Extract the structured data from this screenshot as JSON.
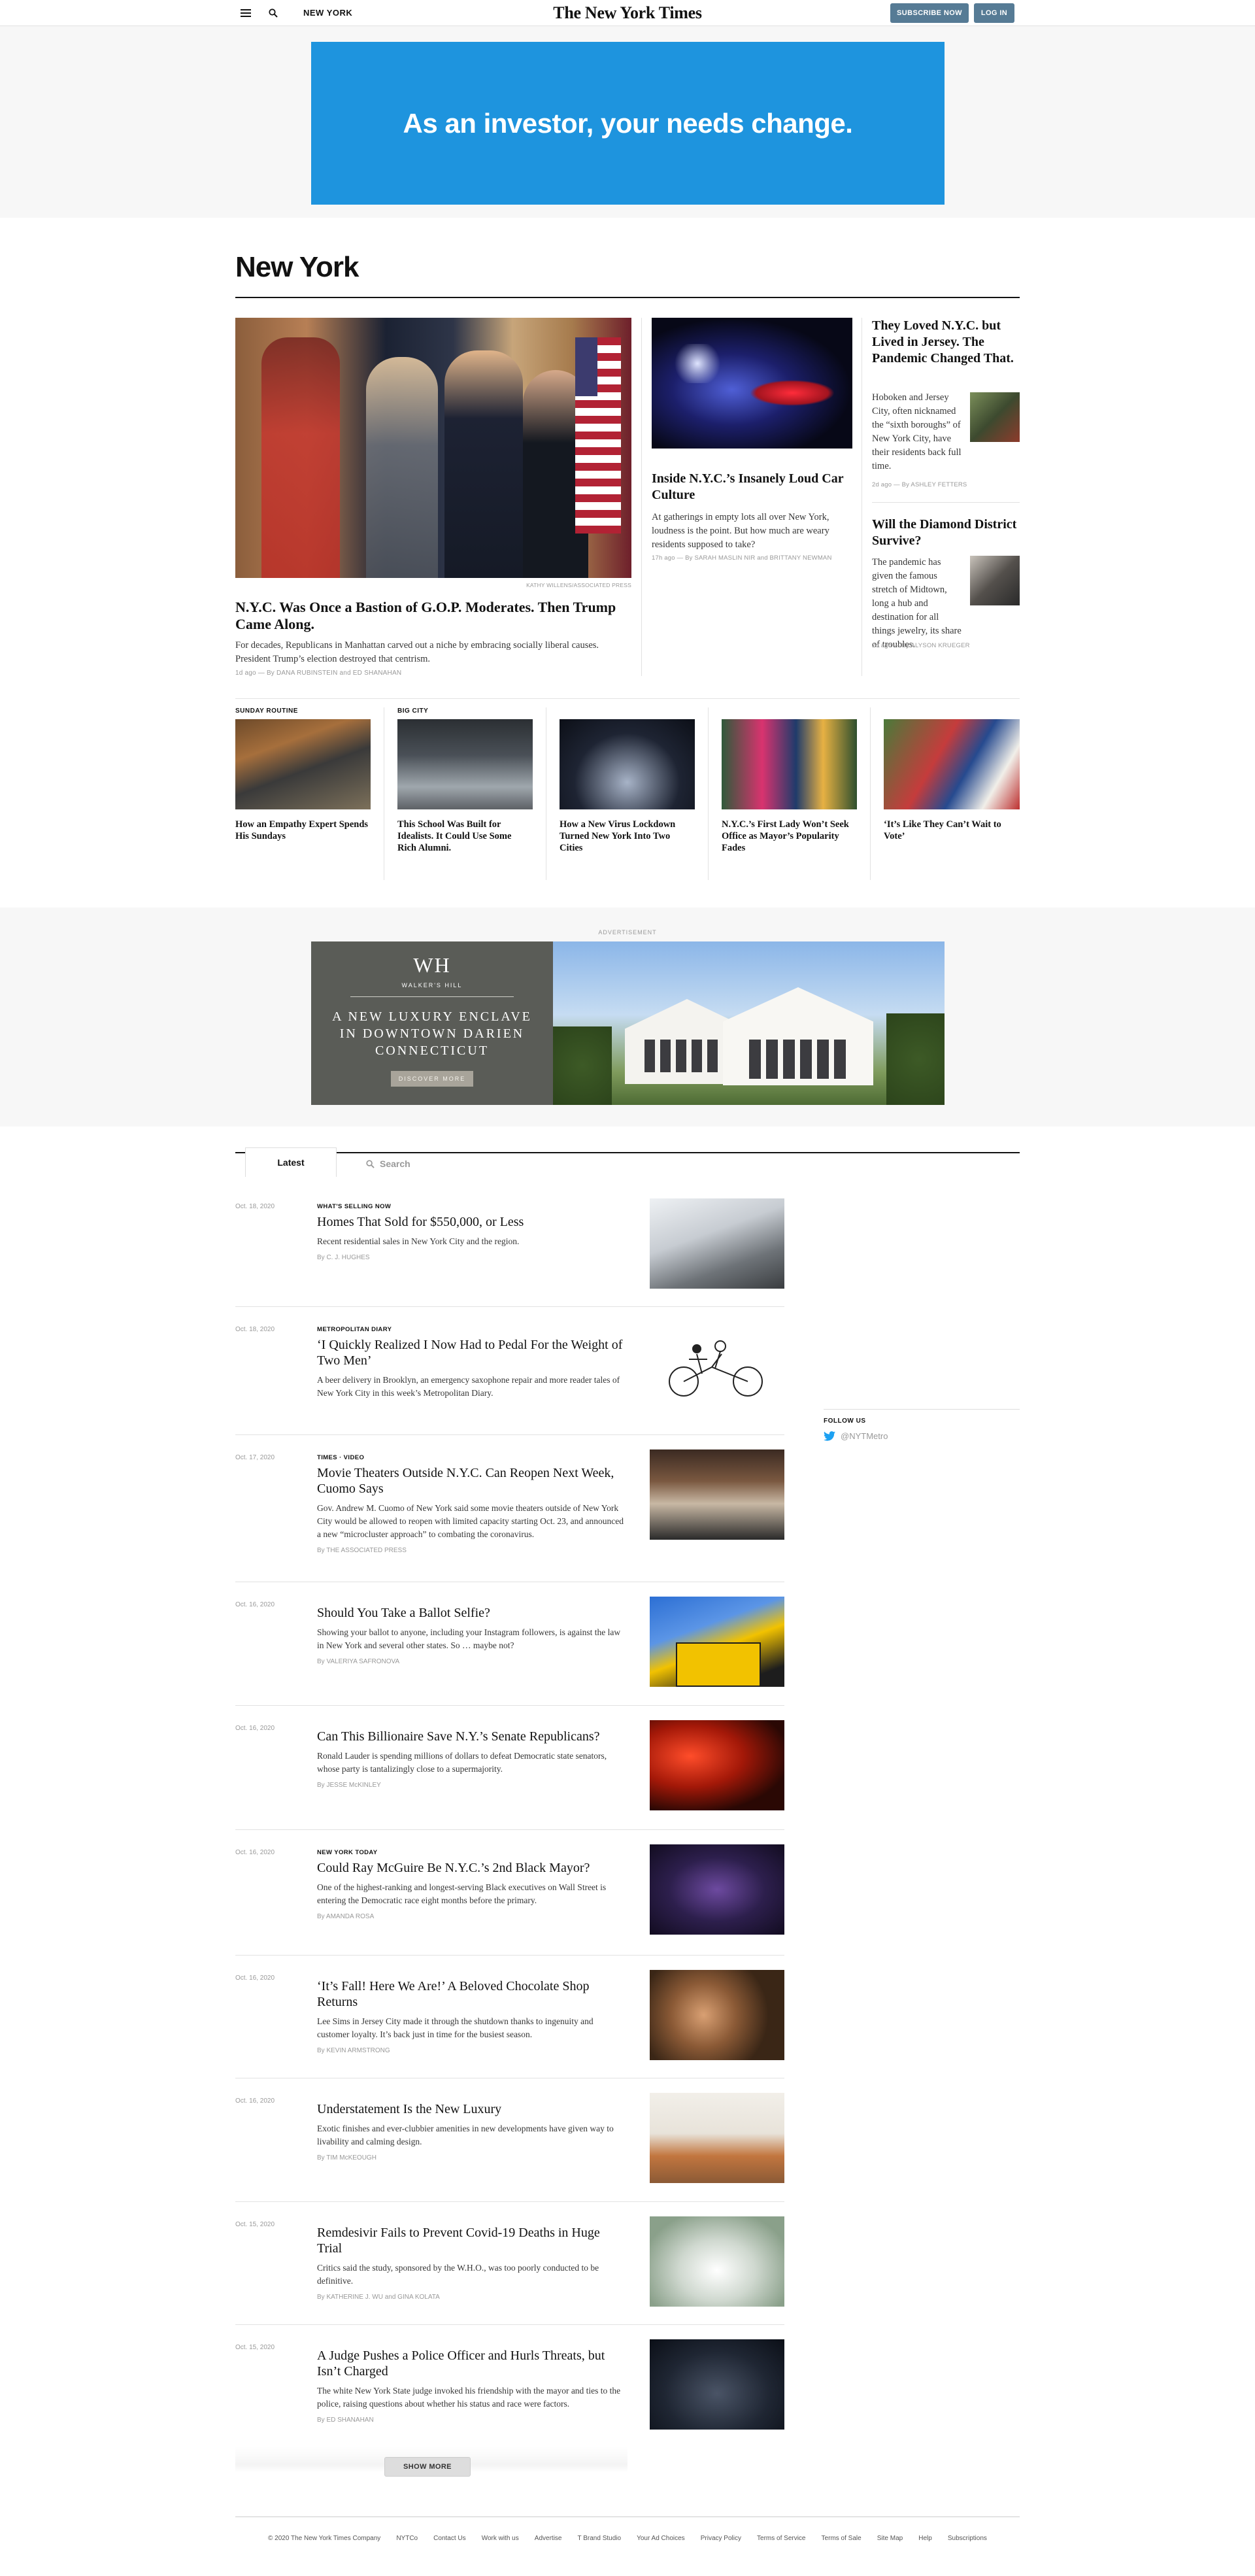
{
  "header": {
    "section_label": "NEW YORK",
    "logo": "The New York Times",
    "subscribe_label": "SUBSCRIBE NOW",
    "login_label": "LOG IN"
  },
  "ad_top": {
    "text": "As an investor, your needs change."
  },
  "section": {
    "title": "New York"
  },
  "lead": {
    "credit": "Kathy Willens/Associated Press",
    "headline": "N.Y.C. Was Once a Bastion of G.O.P. Moderates. Then Trump Came Along.",
    "summary": "For decades, Republicans in Manhattan carved out a niche by embracing socially liberal causes. President Trump’s election destroyed that centrism.",
    "byline": "1d ago — By DANA RUBINSTEIN and ED SHANAHAN"
  },
  "second": {
    "headline": "Inside N.Y.C.’s Insanely Loud Car Culture",
    "summary": "At gatherings in empty lots all over New York, loudness is the point. But how much are weary residents supposed to take?",
    "byline": "17h ago — By SARAH MASLIN NIR and BRITTANY NEWMAN"
  },
  "right": [
    {
      "headline": "They Loved N.Y.C. but Lived in Jersey. The Pandemic Changed That.",
      "summary": "Hoboken and Jersey City, often nicknamed the “sixth boroughs” of New York City, have their residents back full time.",
      "byline": "2d ago — By ASHLEY FETTERS"
    },
    {
      "headline": "Will the Diamond District Survive?",
      "summary": "The pandemic has given the famous stretch of Midtown, long a hub and destination for all things jewelry, its share of troubles.",
      "byline": "2d ago — By ALYSON KRUEGER"
    }
  ],
  "strip": [
    {
      "kicker": "SUNDAY ROUTINE",
      "headline": "How an Empathy Expert Spends His Sundays"
    },
    {
      "kicker": "BIG CITY",
      "headline": "This School Was Built for Idealists. It Could Use Some Rich Alumni."
    },
    {
      "kicker": "",
      "headline": "How a New Virus Lockdown Turned New York Into Two Cities"
    },
    {
      "kicker": "",
      "headline": "N.Y.C.’s First Lady Won’t Seek Office as Mayor’s Popularity Fades"
    },
    {
      "kicker": "",
      "headline": "‘It’s Like They Can’t Wait to Vote’"
    }
  ],
  "ad_mid": {
    "label": "ADVERTISEMENT",
    "brand": "WALKER'S HILL",
    "line1": "A NEW LUXURY ENCLAVE",
    "line2": "IN DOWNTOWN DARIEN",
    "line3": "CONNECTICUT",
    "cta": "DISCOVER MORE"
  },
  "latest": {
    "tab_label": "Latest",
    "search_placeholder": "Search",
    "stories": [
      {
        "date": "Oct. 18, 2020",
        "kicker": "WHAT'S SELLING NOW",
        "headline": "Homes That Sold for $550,000, or Less",
        "dek": "Recent residential sales in New York City and the region.",
        "byline": "By C. J. HUGHES"
      },
      {
        "date": "Oct. 18, 2020",
        "kicker": "METROPOLITAN DIARY",
        "headline": "‘I Quickly Realized I Now Had to Pedal For the Weight of Two Men’",
        "dek": "A beer delivery in Brooklyn, an emergency saxophone repair and more reader tales of New York City in this week’s Metropolitan Diary.",
        "byline": ""
      },
      {
        "date": "Oct. 17, 2020",
        "kicker": "TIMES · VIDEO",
        "headline": "Movie Theaters Outside N.Y.C. Can Reopen Next Week, Cuomo Says",
        "dek": "Gov. Andrew M. Cuomo of New York said some movie theaters outside of New York City would be allowed to reopen with limited capacity starting Oct. 23, and announced a new “microcluster approach” to combating the coronavirus.",
        "byline": "By THE ASSOCIATED PRESS"
      },
      {
        "date": "Oct. 16, 2020",
        "kicker": "",
        "headline": "Should You Take a Ballot Selfie?",
        "dek": "Showing your ballot to anyone, including your Instagram followers, is against the law in New York and several other states. So … maybe not?",
        "byline": "By VALERIYA SAFRONOVA"
      },
      {
        "date": "Oct. 16, 2020",
        "kicker": "",
        "headline": "Can This Billionaire Save N.Y.’s Senate Republicans?",
        "dek": "Ronald Lauder is spending millions of dollars to defeat Democratic state senators, whose party is tantalizingly close to a supermajority.",
        "byline": "By JESSE McKINLEY"
      },
      {
        "date": "Oct. 16, 2020",
        "kicker": "NEW YORK TODAY",
        "headline": "Could Ray McGuire Be N.Y.C.’s 2nd Black Mayor?",
        "dek": "One of the highest-ranking and longest-serving Black executives on Wall Street is entering the Democratic race eight months before the primary.",
        "byline": "By AMANDA ROSA"
      },
      {
        "date": "Oct. 16, 2020",
        "kicker": "",
        "headline": "‘It’s Fall! Here We Are!’ A Beloved Chocolate Shop Returns",
        "dek": "Lee Sims in Jersey City made it through the shutdown thanks to ingenuity and customer loyalty. It’s back just in time for the busiest season.",
        "byline": "By KEVIN ARMSTRONG"
      },
      {
        "date": "Oct. 16, 2020",
        "kicker": "",
        "headline": "Understatement Is the New Luxury",
        "dek": "Exotic finishes and ever-clubbier amenities in new developments have given way to livability and calming design.",
        "byline": "By TIM McKEOUGH"
      },
      {
        "date": "Oct. 15, 2020",
        "kicker": "",
        "headline": "Remdesivir Fails to Prevent Covid-19 Deaths in Huge Trial",
        "dek": "Critics said the study, sponsored by the W.H.O., was too poorly conducted to be definitive.",
        "byline": "By KATHERINE J. WU and GINA KOLATA"
      },
      {
        "date": "Oct. 15, 2020",
        "kicker": "",
        "headline": "A Judge Pushes a Police Officer and Hurls Threats, but Isn’t Charged",
        "dek": "The white New York State judge invoked his friendship with the mayor and ties to the police, raising questions about whether his status and race were factors.",
        "byline": "By ED SHANAHAN"
      }
    ],
    "show_more": "SHOW MORE"
  },
  "sidebar": {
    "follow_label": "FOLLOW US",
    "twitter_handle": "@NYTMetro"
  },
  "footer": {
    "links": [
      "© 2020 The New York Times Company",
      "NYTCo",
      "Contact Us",
      "Work with us",
      "Advertise",
      "T Brand Studio",
      "Your Ad Choices",
      "Privacy Policy",
      "Terms of Service",
      "Terms of Sale",
      "Site Map",
      "Help",
      "Subscriptions"
    ]
  },
  "colors": {
    "brand_button": "#567b95",
    "ad_blue": "#1e94de",
    "twitter_blue": "#1da1f2"
  }
}
